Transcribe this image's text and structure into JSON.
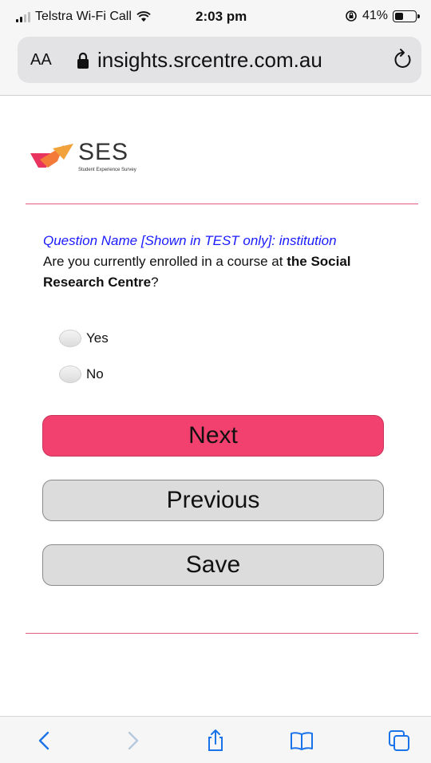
{
  "status": {
    "carrier": "Telstra Wi-Fi Call",
    "time": "2:03 pm",
    "battery": "41%",
    "battery_level": 0.41
  },
  "browser": {
    "text_size_label": "AA",
    "url": "insights.srcentre.com.au"
  },
  "logo": {
    "title": "SES",
    "subtitle": "Student Experience Survey"
  },
  "question": {
    "name_label": "Question Name [Shown in TEST only]: institution",
    "text_part1": "Are you currently enrolled in a course at ",
    "text_bold1": "the Social Research Centre",
    "text_part2": "?"
  },
  "options": [
    {
      "label": "Yes"
    },
    {
      "label": "No"
    }
  ],
  "buttons": {
    "next": "Next",
    "previous": "Previous",
    "save": "Save"
  },
  "colors": {
    "accent": "#f2416e",
    "divider": "#e25a7f",
    "test_label": "#1a1aff",
    "ios_blue": "#1a73e8"
  }
}
